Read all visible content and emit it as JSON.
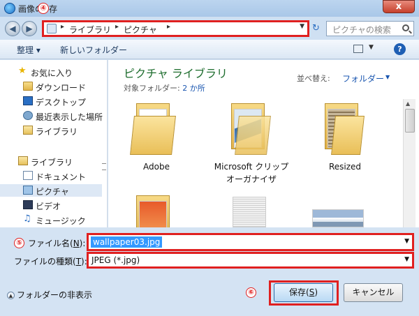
{
  "window": {
    "title_start": "画像の",
    "title_end": "存",
    "badge_4": "④",
    "close_symbol": "x"
  },
  "address": {
    "crumbs": [
      "ライブラリ",
      "ピクチャ"
    ],
    "search_placeholder": "ピクチャの検索"
  },
  "toolbar": {
    "organize": "整理 ▾",
    "new_folder": "新しいフォルダー",
    "help": "?"
  },
  "nav": {
    "favorites": "お気に入り",
    "downloads": "ダウンロード",
    "desktop": "デスクトップ",
    "recent": "最近表示した場所",
    "library_fav": "ライブラリ",
    "libraries": "ライブラリ",
    "documents": "ドキュメント",
    "pictures": "ピクチャ",
    "videos": "ビデオ",
    "music": "ミュージック"
  },
  "content": {
    "title": "ピクチャ ライブラリ",
    "target_label": "対象フォルダー: ",
    "target_link": "2 か所",
    "sort_label": "並べ替え:",
    "sort_value": "フォルダー",
    "folders": [
      {
        "name": "Adobe"
      },
      {
        "name": "Microsoft クリップ オーガナイザ"
      },
      {
        "name": "Resized"
      }
    ]
  },
  "form": {
    "badge_5": "⑤",
    "filename_label_pre": "ファイル名(",
    "filename_label_key": "N",
    "filename_label_post": "):",
    "filename_value": "wallpaper03.jpg",
    "filetype_label_pre": "ファイルの種類(",
    "filetype_label_key": "T",
    "filetype_label_post": "):",
    "filetype_value": "JPEG (*.jpg)",
    "hide_folders": "フォルダーの非表示",
    "badge_6": "⑥",
    "save_pre": "保存(",
    "save_key": "S",
    "save_post": ")",
    "cancel": "キャンセル"
  },
  "colors": {
    "highlight_red": "#e02020",
    "selection_blue": "#3399ff",
    "library_title_green": "#1e6d2e"
  }
}
